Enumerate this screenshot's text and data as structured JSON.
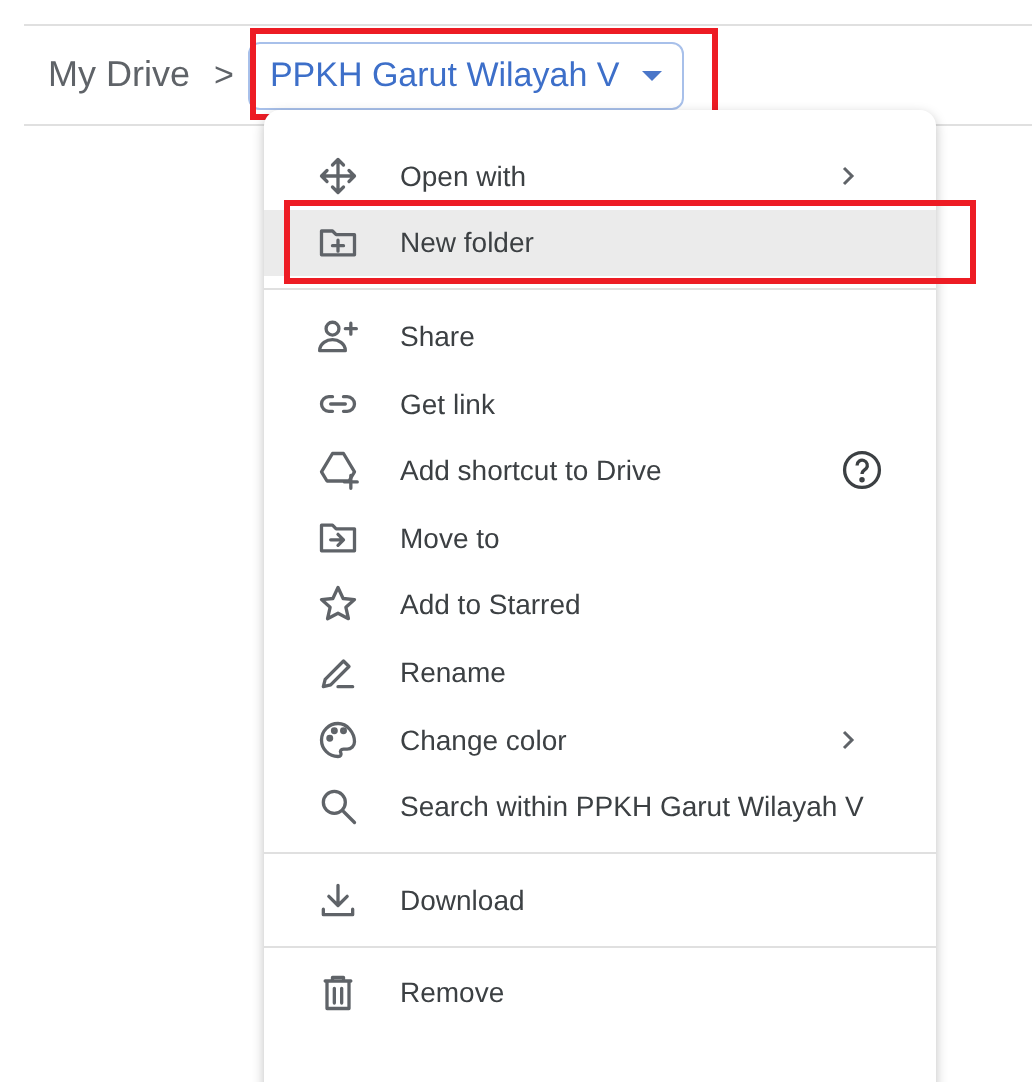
{
  "breadcrumb": {
    "root": "My Drive",
    "separator": ">",
    "current": {
      "label": "PPKH Garut Wilayah V",
      "annotated": true
    }
  },
  "menu": {
    "sections": [
      {
        "items": [
          {
            "label": "Open with",
            "submenu": true,
            "selected": false,
            "annotated": false
          },
          {
            "label": "New folder",
            "submenu": false,
            "selected": true,
            "annotated": true
          }
        ]
      },
      {
        "items": [
          {
            "label": "Share",
            "submenu": false,
            "selected": false,
            "annotated": false
          },
          {
            "label": "Get link",
            "submenu": false,
            "selected": false,
            "annotated": false
          },
          {
            "label": "Add shortcut to Drive",
            "submenu": false,
            "help": true,
            "selected": false,
            "annotated": false
          },
          {
            "label": "Move to",
            "submenu": false,
            "selected": false,
            "annotated": false
          },
          {
            "label": "Add to Starred",
            "submenu": false,
            "selected": false,
            "annotated": false
          },
          {
            "label": "Rename",
            "submenu": false,
            "selected": false,
            "annotated": false
          },
          {
            "label": "Change color",
            "submenu": true,
            "selected": false,
            "annotated": false
          },
          {
            "label": "Search within PPKH Garut Wilayah V",
            "submenu": false,
            "selected": false,
            "annotated": false
          }
        ]
      },
      {
        "items": [
          {
            "label": "Download",
            "submenu": false,
            "selected": false,
            "annotated": false
          }
        ]
      },
      {
        "items": [
          {
            "label": "Remove",
            "submenu": false,
            "selected": false,
            "annotated": false
          }
        ]
      }
    ]
  }
}
